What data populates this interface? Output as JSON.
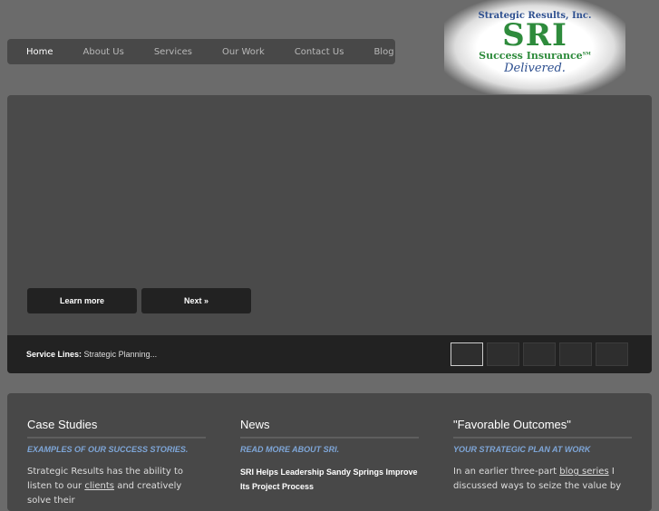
{
  "nav": {
    "items": [
      "Home",
      "About Us",
      "Services",
      "Our Work",
      "Contact Us",
      "Blog"
    ]
  },
  "logo": {
    "line1": "Strategic Results, Inc.",
    "line2": "SRI",
    "line3": "Success Insurance",
    "sm": "SM",
    "line4": "Delivered."
  },
  "slider": {
    "learn_more": "Learn more",
    "next": "Next »",
    "caption_label": "Service Lines:",
    "caption_text": "Strategic Planning...",
    "active_thumb": 1,
    "thumb_count": 5
  },
  "columns": [
    {
      "title": "Case Studies",
      "subtitle": "EXAMPLES OF OUR SUCCESS STORIES.",
      "text_a": "Strategic Results has the ability to listen to our ",
      "link": "clients",
      "text_b": " and creatively solve their"
    },
    {
      "title": "News",
      "subtitle": "READ MORE ABOUT SRI.",
      "headline": "SRI Helps Leadership Sandy Springs Improve Its Project Process"
    },
    {
      "title": "\"Favorable Outcomes\"",
      "subtitle": "YOUR STRATEGIC PLAN AT WORK",
      "text_a": "In an earlier three-part ",
      "link": "blog series",
      "text_b": " I discussed ways to seize the value by"
    }
  ]
}
